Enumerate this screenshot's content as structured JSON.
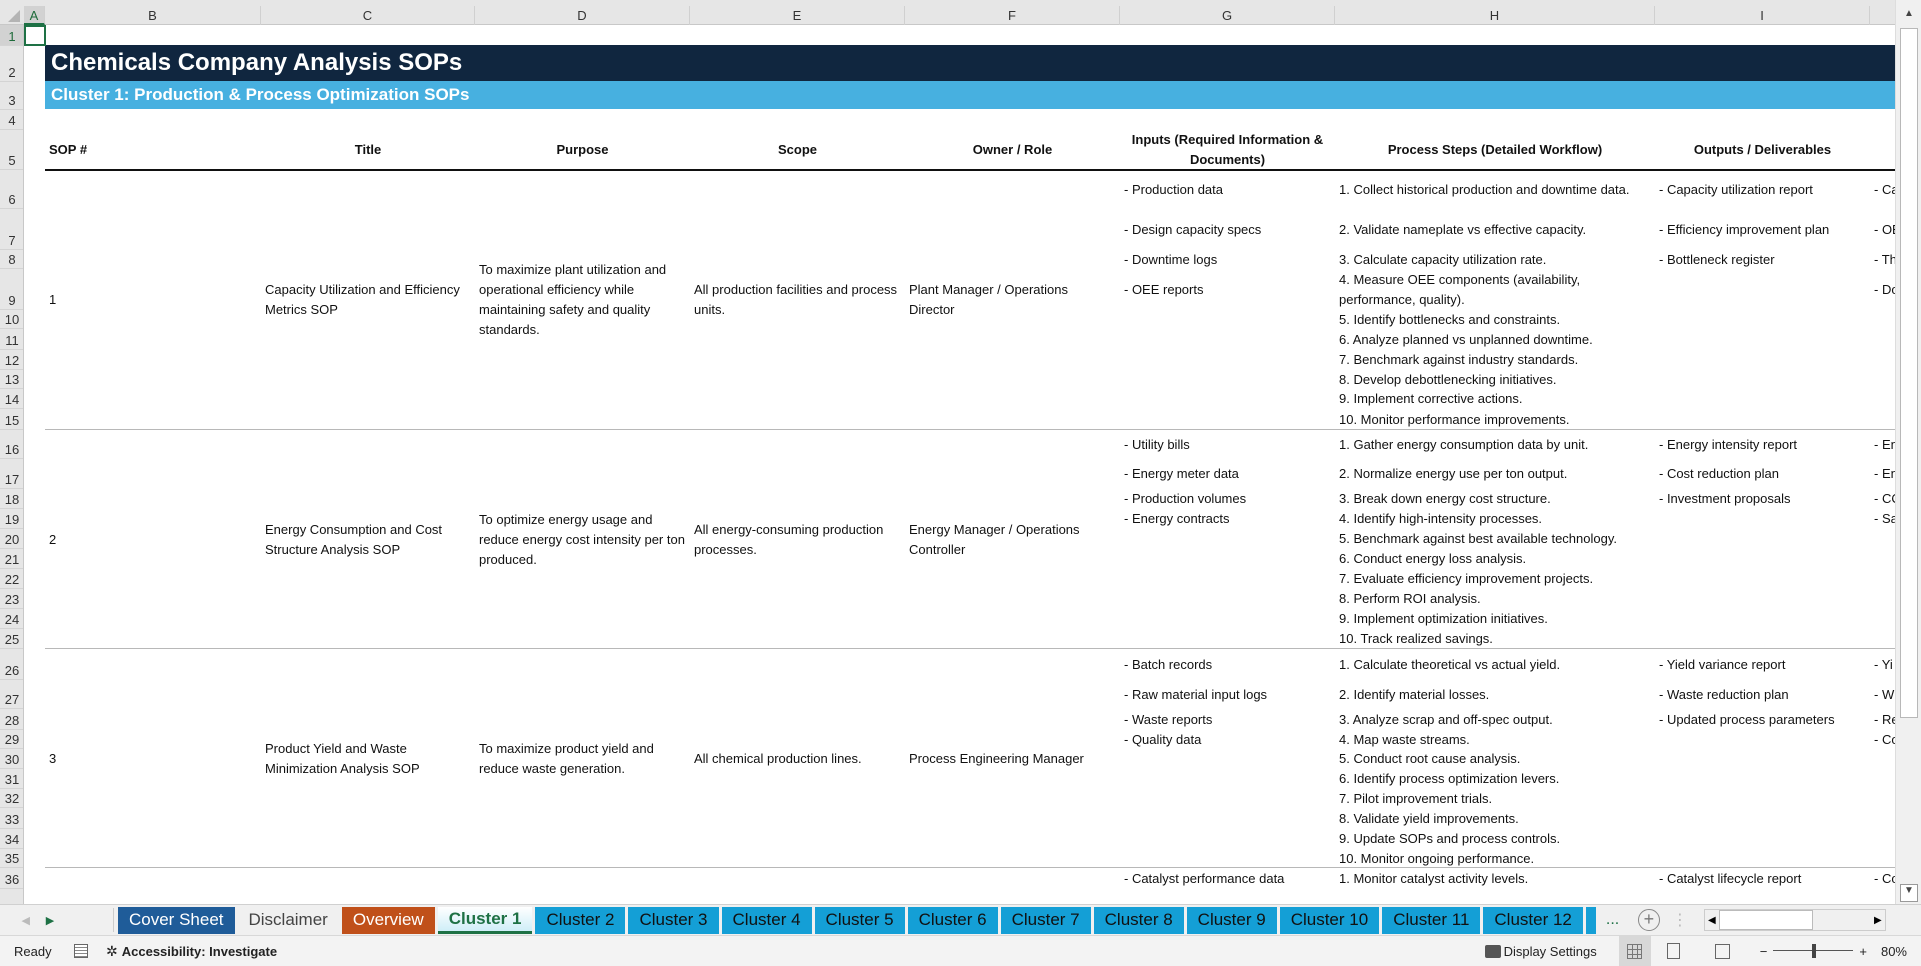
{
  "columns": [
    "A",
    "B",
    "C",
    "D",
    "E",
    "F",
    "G",
    "H",
    "I"
  ],
  "title": "Chemicals Company Analysis SOPs",
  "subtitle": "Cluster 1: Production & Process Optimization SOPs",
  "headers": {
    "sop": "SOP #",
    "title": "Title",
    "purpose": "Purpose",
    "scope": "Scope",
    "owner": "Owner / Role",
    "inputs": "Inputs (Required Information & Documents)",
    "steps": "Process Steps (Detailed Workflow)",
    "outputs": "Outputs / Deliverables"
  },
  "sops": [
    {
      "number": "1",
      "title": "Capacity Utilization and Efficiency Metrics SOP",
      "purpose": "To maximize plant utilization and operational efficiency while maintaining safety and quality standards.",
      "scope": "All production facilities and process units.",
      "owner": "Plant Manager / Operations Director",
      "inputs": [
        "- Production data",
        "- Design capacity specs",
        "- Downtime logs",
        "- OEE reports"
      ],
      "steps": [
        "1. Collect historical production and downtime data.",
        "2. Validate nameplate vs effective capacity.",
        "3. Calculate capacity utilization rate.",
        "4. Measure OEE components (availability, performance, quality).",
        "5. Identify bottlenecks and constraints.",
        "6. Analyze planned vs unplanned downtime.",
        "7. Benchmark against industry standards.",
        "8. Develop debottlenecking initiatives.",
        "9. Implement corrective actions.",
        "10. Monitor performance improvements."
      ],
      "outputs": [
        "- Capacity utilization report",
        "- Efficiency improvement plan",
        "- Bottleneck register"
      ],
      "next_col": [
        "- Ca",
        "- OE",
        "- Th",
        "- Do"
      ]
    },
    {
      "number": "2",
      "title": "Energy Consumption and Cost Structure Analysis SOP",
      "purpose": "To optimize energy usage and reduce energy cost intensity per ton produced.",
      "scope": "All energy-consuming production processes.",
      "owner": "Energy Manager / Operations Controller",
      "inputs": [
        "- Utility bills",
        "- Energy meter data",
        "- Production volumes",
        "- Energy contracts"
      ],
      "steps": [
        "1. Gather energy consumption data by unit.",
        "2. Normalize energy use per ton output.",
        "3. Break down energy cost structure.",
        "4. Identify high-intensity processes.",
        "5. Benchmark against best available technology.",
        "6. Conduct energy loss analysis.",
        "7. Evaluate efficiency improvement projects.",
        "8. Perform ROI analysis.",
        "9. Implement optimization initiatives.",
        "10. Track realized savings."
      ],
      "outputs": [
        "- Energy intensity report",
        "- Cost reduction plan",
        "- Investment proposals"
      ],
      "next_col": [
        "- En",
        "- En",
        "- CO",
        "- Sa"
      ]
    },
    {
      "number": "3",
      "title": "Product Yield and Waste Minimization Analysis SOP",
      "purpose": "To maximize product yield and reduce waste generation.",
      "scope": "All chemical production lines.",
      "owner": "Process Engineering Manager",
      "inputs": [
        "- Batch records",
        "- Raw material input logs",
        "- Waste reports",
        "- Quality data"
      ],
      "steps": [
        "1. Calculate theoretical vs actual yield.",
        "2. Identify material losses.",
        "3. Analyze scrap and off-spec output.",
        "4. Map waste streams.",
        "5. Conduct root cause analysis.",
        "6. Identify process optimization levers.",
        "7. Pilot improvement trials.",
        "8. Validate yield improvements.",
        "9. Update SOPs and process controls.",
        "10. Monitor ongoing performance."
      ],
      "outputs": [
        "- Yield variance report",
        "- Waste reduction plan",
        "- Updated process parameters"
      ],
      "next_col": [
        "- Yi",
        "- W",
        "- Re",
        "- Co"
      ]
    },
    {
      "inputs": [
        "- Catalyst performance data"
      ],
      "steps": [
        "1. Monitor catalyst activity levels."
      ],
      "outputs": [
        "- Catalyst lifecycle report"
      ],
      "next_col": [
        "- Co"
      ]
    }
  ],
  "tabs": [
    {
      "label": "Cover Sheet",
      "bg": "#1f5c99",
      "fg": "#ffffff"
    },
    {
      "label": "Disclaimer",
      "bg": "#e8e8e8",
      "fg": "#444444"
    },
    {
      "label": "Overview",
      "bg": "#c0501a",
      "fg": "#ffffff"
    },
    {
      "label": "Cluster 1",
      "bg": "#ffffff",
      "fg": "#1e7145",
      "active": true
    },
    {
      "label": "Cluster 2"
    },
    {
      "label": "Cluster 3"
    },
    {
      "label": "Cluster 4"
    },
    {
      "label": "Cluster 5"
    },
    {
      "label": "Cluster 6"
    },
    {
      "label": "Cluster 7"
    },
    {
      "label": "Cluster 8"
    },
    {
      "label": "Cluster 9"
    },
    {
      "label": "Cluster 10"
    },
    {
      "label": "Cluster 11"
    },
    {
      "label": "Cluster 12"
    }
  ],
  "tabs_more": "...",
  "status": {
    "ready": "Ready",
    "accessibility": "Accessibility: Investigate",
    "display_settings": "Display Settings",
    "zoom": "80%",
    "zoom_fraction": 0.8
  }
}
